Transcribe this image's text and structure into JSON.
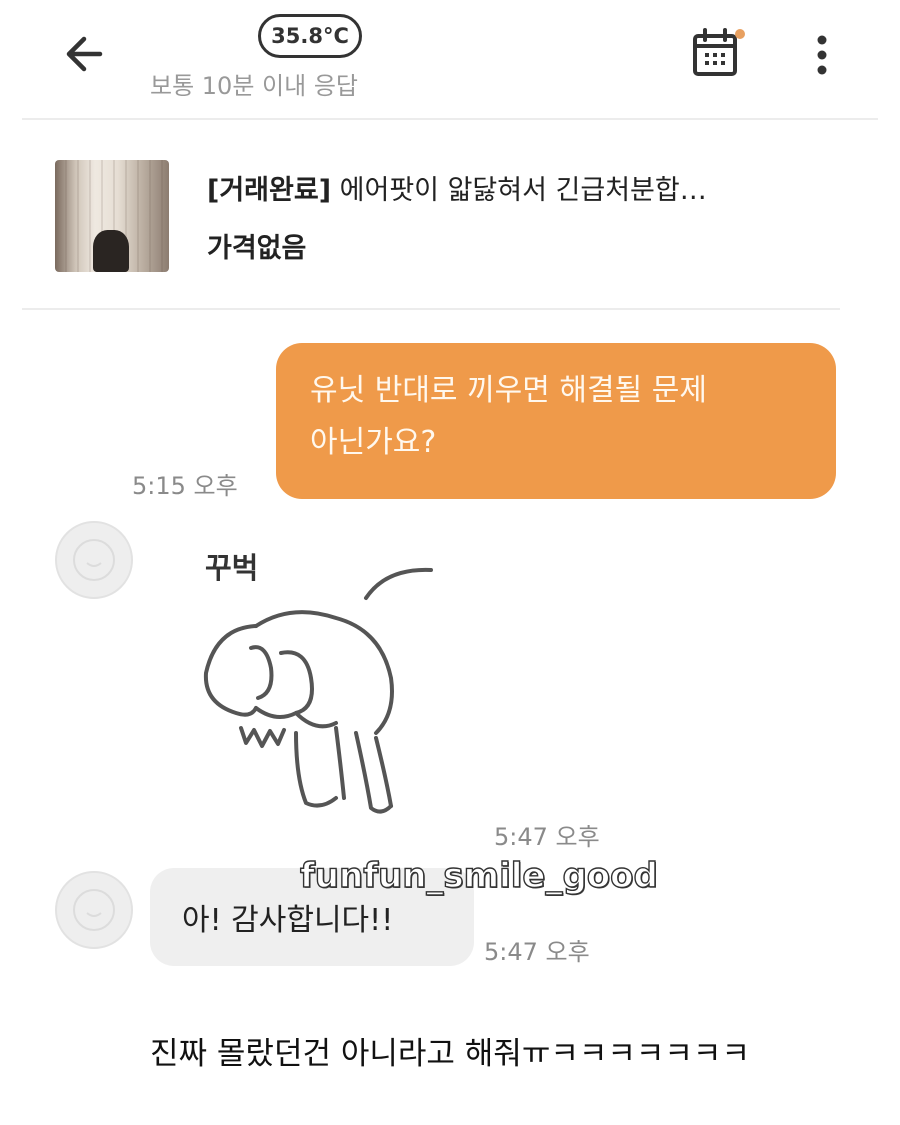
{
  "header": {
    "temperature": "35.8°C",
    "response_info": "보통 10분 이내 응답",
    "icons": {
      "back": "back-arrow-icon",
      "calendar": "calendar-icon",
      "more": "more-vertical-icon"
    },
    "calendar_dot_color": "#e8a060"
  },
  "product": {
    "status_tag": "[거래완료]",
    "title": "에어팟이 앏닳혀서 긴급처분합…",
    "price": "가격없음"
  },
  "messages": {
    "outgoing": {
      "line1": "유닛 반대로 끼우면 해결될 문제",
      "line2": "아닌가요?",
      "time": "5:15 오후",
      "bubble_color": "#ef9a4a"
    },
    "sticker": {
      "label": "꾸벅",
      "time": "5:47 오후"
    },
    "incoming": {
      "text": "아! 감사합니다!!",
      "time": "5:47 오후"
    }
  },
  "watermark": "funfun_smile_good",
  "caption": "진짜 몰랐던건 아니라고 해줘ㅠㅋㅋㅋㅋㅋㅋㅋ"
}
